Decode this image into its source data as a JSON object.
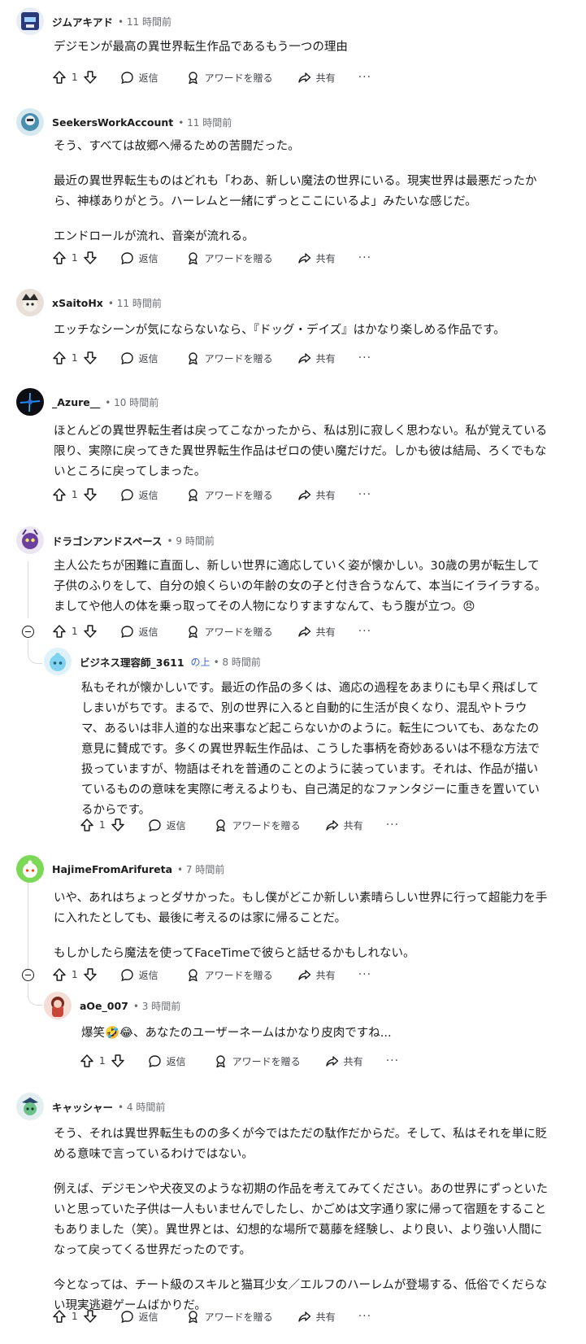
{
  "actions": {
    "reply": "返信",
    "award": "アワードを贈る",
    "share": "共有",
    "more": "···"
  },
  "comments": [
    {
      "username": "ジムアキアド",
      "time": "• 11 時間前",
      "score": "1",
      "paragraphs": [
        "デジモンが最高の異世界転生作品であるもう一つの理由"
      ]
    },
    {
      "username": "SeekersWorkAccount",
      "time": "• 11 時間前",
      "score": "1",
      "paragraphs": [
        "そう、すべては故郷へ帰るための苦闘だった。",
        "最近の異世界転生ものはどれも「わあ、新しい魔法の世界にいる。現実世界は最悪だったから、神様ありがとう。ハーレムと一緒にずっとここにいるよ」みたいな感じだ。",
        "エンドロールが流れ、音楽が流れる。"
      ]
    },
    {
      "username": "xSaitoHx",
      "time": "• 11 時間前",
      "score": "1",
      "paragraphs": [
        "エッチなシーンが気にならないなら、『ドッグ・デイズ』はかなり楽しめる作品です。"
      ]
    },
    {
      "username": "_Azure__",
      "time": "• 10 時間前",
      "score": "1",
      "paragraphs": [
        "ほとんどの異世界転生者は戻ってこなかったから、私は別に寂しく思わない。私が覚えている限り、実際に戻ってきた異世界転生作品はゼロの使い魔だけだ。しかも彼は結局、ろくでもないところに戻ってしまった。"
      ]
    },
    {
      "username": "ドラゴンアンドスペース",
      "time": "• 9 時間前",
      "score": "1",
      "paragraphs": [
        "主人公たちが困難に直面し、新しい世界に適応していく姿が懐かしい。30歳の男が転生して子供のふりをして、自分の娘くらいの年齢の女の子と付き合うなんて、本当にイライラする。ましてや他人の体を乗っ取ってその人物になりすますなんて、もう腹が立つ。😠"
      ]
    },
    {
      "username": "ビジネス理容師_3611",
      "op": "の上",
      "time": "• 8 時間前",
      "score": "1",
      "paragraphs": [
        "私もそれが懐かしいです。最近の作品の多くは、適応の過程をあまりにも早く飛ばしてしまいがちです。まるで、別の世界に入ると自動的に生活が良くなり、混乱やトラウマ、あるいは非人道的な出来事など起こらないかのように。転生についても、あなたの意見に賛成です。多くの異世界転生作品は、こうした事柄を奇妙あるいは不穏な方法で扱っていますが、物語はそれを普通のことのように装っています。それは、作品が描いているものの意味を実際に考えるよりも、自己満足的なファンタジーに重きを置いているからです。"
      ]
    },
    {
      "username": "HajimeFromArifureta",
      "time": "• 7 時間前",
      "score": "1",
      "paragraphs": [
        "いや、あれはちょっとダサかった。もし僕がどこか新しい素晴らしい世界に行って超能力を手に入れたとしても、最後に考えるのは家に帰ることだ。",
        "もしかしたら魔法を使ってFaceTimeで彼らと話せるかもしれない。"
      ]
    },
    {
      "username": "aOe_007",
      "time": "• 3 時間前",
      "score": "1",
      "paragraphs": [
        "爆笑🤣😂、あなたのユーザーネームはかなり皮肉ですね..."
      ]
    },
    {
      "username": "キャッシャー",
      "time": "• 4 時間前",
      "score": "1",
      "paragraphs": [
        "そう、それは異世界転生ものの多くが今ではただの駄作だからだ。そして、私はそれを単に貶める意味で言っているわけではない。",
        "例えば、デジモンや犬夜叉のような初期の作品を考えてみてください。あの世界にずっといたいと思っていた子供は一人もいませんでしたし、かごめは文字通り家に帰って宿題をすることもありました（笑）。異世界とは、幻想的な場所で葛藤を経験し、より良い、より強い人間になって戻ってくる世界だったのです。",
        "今となっては、チート級のスキルと猫耳少女／エルフのハーレムが登場する、低俗でくだらない現実逃避ゲームばかりだ。"
      ]
    }
  ]
}
